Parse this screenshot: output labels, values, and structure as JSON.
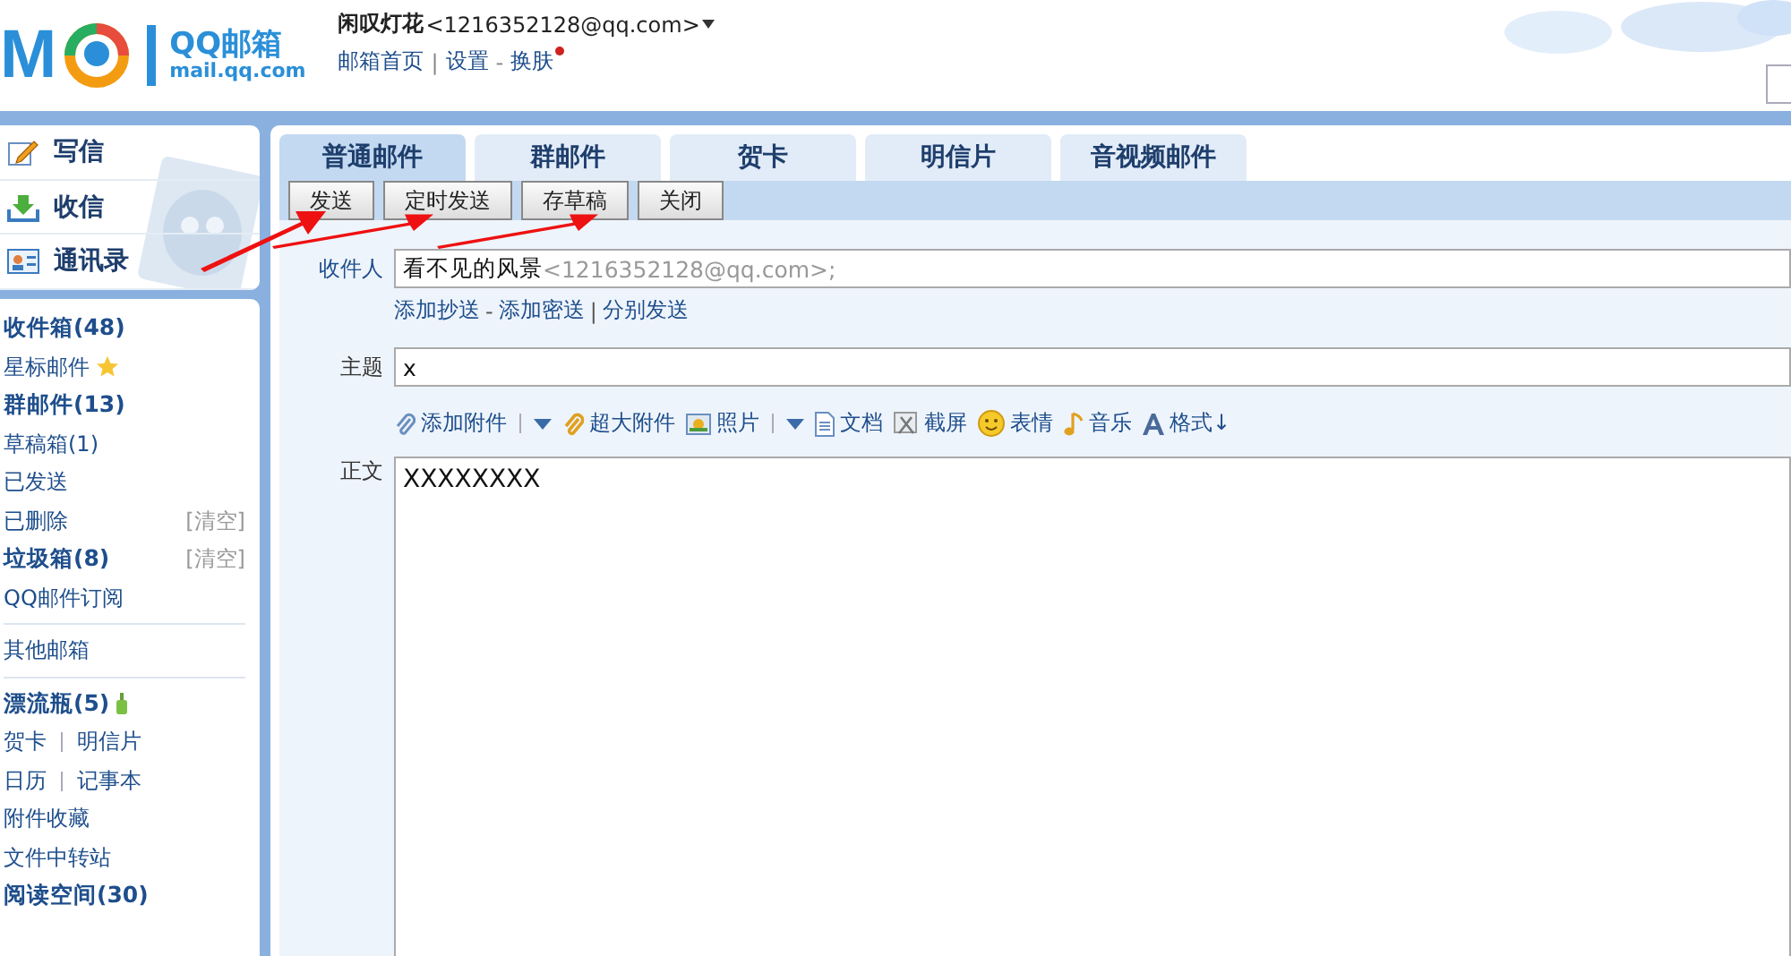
{
  "header": {
    "logo_mark": "M",
    "logo_name": "QQ邮箱",
    "logo_url": "mail.qq.com",
    "user_name": "闲叹灯花",
    "user_email": "<1216352128@qq.com>",
    "links": [
      {
        "label": "邮箱首页",
        "notify": false
      },
      {
        "sep": "|",
        "label": "设置",
        "notify": false
      },
      {
        "sep": "-",
        "label": "换肤",
        "notify": true
      }
    ]
  },
  "quick_actions": [
    {
      "label": "写信",
      "kind": "write"
    },
    {
      "label": "收信",
      "kind": "receive"
    },
    {
      "label": "通讯录",
      "kind": "contacts"
    }
  ],
  "folders": [
    {
      "label": "收件箱(48)",
      "bold": true,
      "kind": "plain",
      "group_end": false
    },
    {
      "label": "星标邮件",
      "bold": false,
      "kind": "star",
      "group_end": false
    },
    {
      "label": "群邮件(13)",
      "bold": true,
      "kind": "plain",
      "group_end": false
    },
    {
      "label": "草稿箱(1)",
      "bold": false,
      "kind": "plain",
      "group_end": false
    },
    {
      "label": "已发送",
      "bold": false,
      "kind": "plain",
      "group_end": false
    },
    {
      "label": "已删除",
      "bold": false,
      "action": "[清空]",
      "kind": "plain",
      "group_end": false
    },
    {
      "label": "垃圾箱(8)",
      "bold": true,
      "action": "[清空]",
      "kind": "plain",
      "group_end": false
    },
    {
      "label": "QQ邮件订阅",
      "bold": false,
      "kind": "plain",
      "group_end": true
    },
    {
      "label": "其他邮箱",
      "bold": false,
      "kind": "plain",
      "group_end": true
    },
    {
      "label": "漂流瓶(5)",
      "bold": true,
      "kind": "bottle",
      "group_end": false
    }
  ],
  "more_links": [
    {
      "items": [
        "贺卡",
        "明信片"
      ]
    },
    {
      "items": [
        "日历",
        "记事本"
      ]
    },
    {
      "items": [
        "附件收藏"
      ]
    },
    {
      "items": [
        "文件中转站"
      ]
    }
  ],
  "reading": {
    "label": "阅读空间(30)",
    "bold": true
  },
  "tabs": [
    {
      "label": "普通邮件",
      "selected": true
    },
    {
      "label": "群邮件",
      "selected": false
    },
    {
      "label": "贺卡",
      "selected": false
    },
    {
      "label": "明信片",
      "selected": false
    },
    {
      "label": "音视频邮件",
      "selected": false
    }
  ],
  "buttons": [
    "发送",
    "定时发送",
    "存草稿",
    "关闭"
  ],
  "form": {
    "to_label": "收件人",
    "to_name": "看不见的风景",
    "to_email": "<1216352128@qq.com>;",
    "to_links": [
      {
        "label": "添加抄送"
      },
      {
        "sep": "-",
        "label": "添加密送"
      },
      {
        "sep": "|",
        "label": "分别发送"
      }
    ],
    "subject_label": "主题",
    "subject": "x",
    "tools": [
      {
        "label": "添加附件",
        "kind": "clip",
        "menu": true
      },
      {
        "label": "超大附件",
        "kind": "bigclip",
        "menu": false
      },
      {
        "label": "照片",
        "kind": "photo",
        "menu": true
      },
      {
        "label": "文档",
        "kind": "doc",
        "menu": false
      },
      {
        "label": "截屏",
        "kind": "screen",
        "menu": false
      },
      {
        "label": "表情",
        "kind": "smile",
        "menu": false
      },
      {
        "label": "音乐",
        "kind": "music",
        "menu": false
      },
      {
        "label": "格式↓",
        "kind": "format",
        "menu": false
      }
    ],
    "body_label": "正文",
    "body": "XXXXXXXX"
  }
}
